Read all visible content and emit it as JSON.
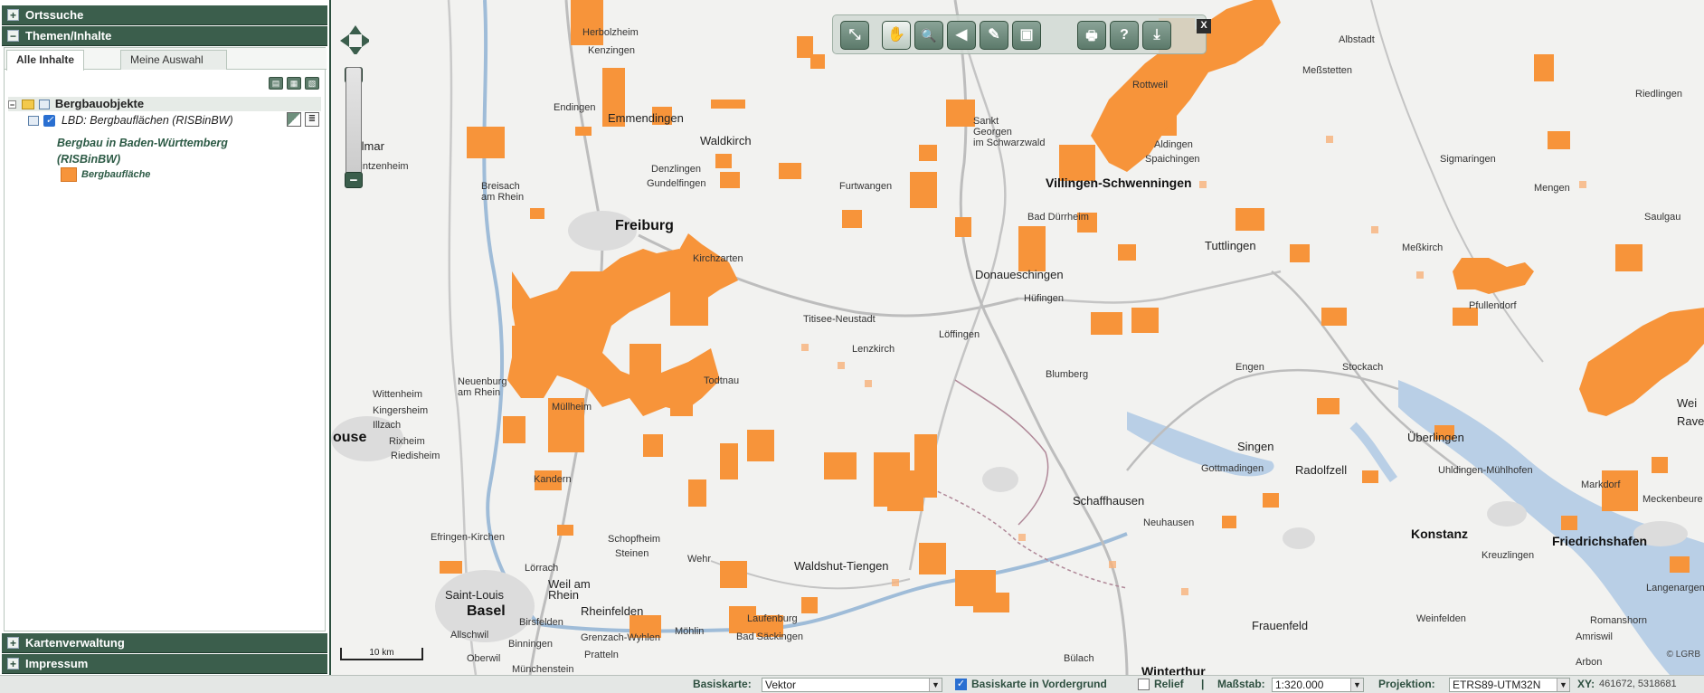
{
  "left_panel": {
    "sections": {
      "ortssuche": "Ortssuche",
      "themen": "Themen/Inhalte",
      "kartenverwaltung": "Kartenverwaltung",
      "impressum": "Impressum"
    },
    "tabs": [
      "Alle Inhalte",
      "Meine Auswahl"
    ],
    "tree": {
      "group_label": "Bergbauobjekte",
      "layer_label": "LBD: Bergbauflächen (RISBinBW)",
      "legend_title": "Bergbau in Baden-Württemberg (RISBinBW)",
      "legend_item": "Bergbaufläche",
      "legend_color": "#f7943a"
    }
  },
  "map": {
    "places": {
      "herbolzheim": "Herbolzheim",
      "kenzingen": "Kenzingen",
      "endingen": "Endingen",
      "emmendingen": "Emmendingen",
      "waldkirch": "Waldkirch",
      "colmar": "Colmar",
      "wintzenheim": "Wintzenheim",
      "denzlingen": "Denzlingen",
      "gundelfingen": "Gundelfingen",
      "breisach": "Breisach\nam Rhein",
      "freiburg": "Freiburg",
      "kirchzarten": "Kirchzarten",
      "furtwangen": "Furtwangen",
      "sanktgeorgen": "Sankt\nGeorgen\nim Schwarzwald",
      "villingen": "Villingen-Schwenningen",
      "baddurrheim": "Bad Dürrheim",
      "donaueschingen": "Donaueschingen",
      "hufingen": "Hüfingen",
      "titisee": "Titisee-Neustadt",
      "lenzkirch": "Lenzkirch",
      "loffingen": "Löffingen",
      "todtnau": "Todtnau",
      "neuenburg": "Neuenburg\nam Rhein",
      "mullheim": "Müllheim",
      "wittenheim": "Wittenheim",
      "kingersheim": "Kingersheim",
      "illzach": "Illzach",
      "mulhouse": "ouse",
      "rixheim": "Rixheim",
      "riedisheim": "Riedisheim",
      "kandern": "Kandern",
      "efringen": "Efringen-Kirchen",
      "schopfheim": "Schopfheim",
      "steinen": "Steinen",
      "wehr": "Wehr",
      "lorrach": "Lörrach",
      "weilamrhein": "Weil am\nRhein",
      "saintlouis": "Saint-Louis",
      "basel": "Basel",
      "birsfelden": "Birsfelden",
      "allschwil": "Allschwil",
      "binningen": "Binningen",
      "oberwil": "Oberwil",
      "munchenstein": "Münchenstein",
      "pratteln": "Pratteln",
      "rheinfelden": "Rheinfelden",
      "grenzach": "Grenzach-Wyhlen",
      "mohlin": "Möhlin",
      "laufenburg": "Laufenburg",
      "badsackingen": "Bad Säckingen",
      "waldshut": "Waldshut-Tiengen",
      "rottweil": "Rottweil",
      "albstadt": "Albstadt",
      "messstetten": "Meßstetten",
      "aldingen": "Aldingen",
      "spaichingen": "Spaichingen",
      "tuttlingen": "Tuttlingen",
      "blumberg": "Blumberg",
      "engen": "Engen",
      "stockach": "Stockach",
      "singen": "Singen",
      "gottmadingen": "Gottmadingen",
      "radolfzell": "Radolfzell",
      "schaffhausen": "Schaffhausen",
      "neuhausen": "Neuhausen",
      "konstanz": "Konstanz",
      "kreuzlingen": "Kreuzlingen",
      "uberlingen": "Überlingen",
      "uhldingen": "Uhldingen-Mühlhofen",
      "markdorf": "Markdorf",
      "meckenbeuren": "Meckenbeure",
      "friedrichshafen": "Friedrichshafen",
      "langenargen": "Langenargen",
      "romanshorn": "Romanshorn",
      "amriswil": "Amriswil",
      "arbon": "Arbon",
      "weinfelden": "Weinfelden",
      "frauenfeld": "Frauenfeld",
      "bulach": "Bülach",
      "winterthur": "Winterthur",
      "sigmaringen": "Sigmaringen",
      "mengen": "Mengen",
      "riedlingen": "Riedlingen",
      "saulgau": "Saulgau",
      "messkirch": "Meßkirch",
      "pfullendorf": "Pfullendorf",
      "ravensburg": "Rave",
      "weh": "Wei"
    },
    "scale_label": "10 km",
    "copyright": "© LGRB"
  },
  "toolbar": {
    "buttons": [
      "zoom-to-extent",
      "pan",
      "zoom",
      "back",
      "edit",
      "print-area",
      "print",
      "help",
      "export"
    ],
    "icons": [
      "⤡",
      "✋",
      "🔍",
      "◀",
      "✎",
      "▣",
      "🖶",
      "?",
      "⤓"
    ],
    "close": "X"
  },
  "status": {
    "basiskarte_label": "Basiskarte:",
    "basiskarte_value": "Vektor",
    "vordergrund_label": "Basiskarte in Vordergrund",
    "vordergrund_checked": true,
    "relief_label": "Relief",
    "separator": "|",
    "massstab_label": "Maßstab:",
    "massstab_value": "1:320.000",
    "projektion_label": "Projektion:",
    "projektion_value": "ETRS89-UTM32N",
    "xy_label": "XY:",
    "xy_value": "461672, 5318681"
  }
}
